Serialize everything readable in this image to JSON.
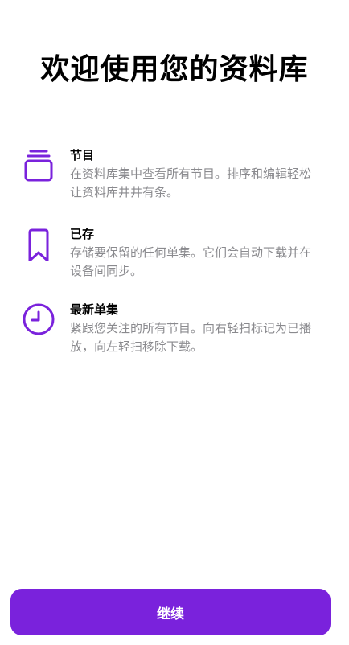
{
  "title": "欢迎使用您的资料库",
  "accent_color": "#7a22dc",
  "features": [
    {
      "icon": "stack-icon",
      "title": "节目",
      "description": "在资料库集中查看所有节目。排序和编辑轻松让资料库井井有条。"
    },
    {
      "icon": "bookmark-icon",
      "title": "已存",
      "description": "存储要保留的任何单集。它们会自动下载并在设备间同步。"
    },
    {
      "icon": "clock-icon",
      "title": "最新单集",
      "description": "紧跟您关注的所有节目。向右轻扫标记为已播放，向左轻扫移除下载。"
    }
  ],
  "continue_label": "继续"
}
